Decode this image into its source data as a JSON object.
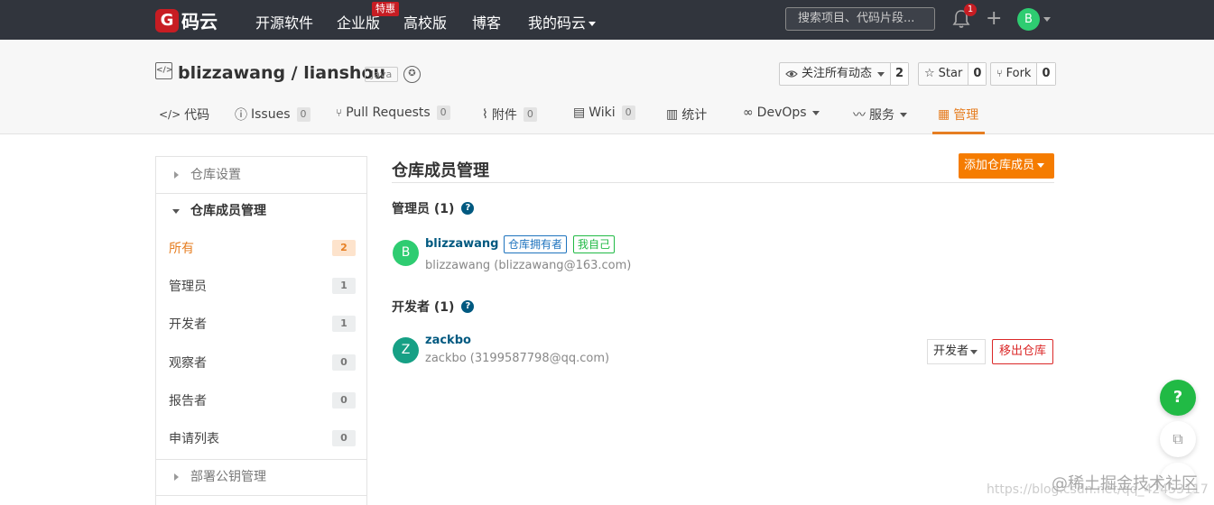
{
  "topnav": {
    "logo_mark": "G",
    "logo_text": "码云",
    "items": [
      "开源软件",
      "企业版",
      "高校版",
      "博客",
      "我的码云"
    ],
    "promo_badge": "特惠",
    "search_placeholder": "搜索项目、代码片段...",
    "notification_count": "1",
    "plus": "+",
    "user_initial": "B"
  },
  "repo": {
    "icon": "</>",
    "title": "blizzawang / lianshou",
    "language": "Java",
    "watch_label": "关注所有动态",
    "watch_count": "2",
    "star_label": "Star",
    "star_count": "0",
    "fork_label": "Fork",
    "fork_count": "0"
  },
  "tabs": {
    "code": "代码",
    "issues": "Issues",
    "issues_count": "0",
    "pulls": "Pull Requests",
    "pulls_count": "0",
    "attachments": "附件",
    "attachments_count": "0",
    "wiki": "Wiki",
    "wiki_count": "0",
    "stats": "统计",
    "devops": "DevOps",
    "services": "服务",
    "manage": "管理"
  },
  "sidebar": {
    "repo_settings": "仓库设置",
    "member_mgmt": "仓库成员管理",
    "items": [
      {
        "label": "所有",
        "count": "2"
      },
      {
        "label": "管理员",
        "count": "1"
      },
      {
        "label": "开发者",
        "count": "1"
      },
      {
        "label": "观察者",
        "count": "0"
      },
      {
        "label": "报告者",
        "count": "0"
      },
      {
        "label": "申请列表",
        "count": "0"
      }
    ],
    "deploy_keys": "部署公钥管理"
  },
  "main": {
    "title": "仓库成员管理",
    "add_button": "添加仓库成员",
    "admins_heading": "管理员 (1)",
    "devs_heading": "开发者 (1)",
    "help": "?",
    "admin": {
      "initial": "B",
      "name": "blizzawang",
      "tag_owner": "仓库拥有者",
      "tag_self": "我自己",
      "sub": "blizzawang (blizzawang@163.com)"
    },
    "dev": {
      "initial": "Z",
      "name": "zackbo",
      "sub": "zackbo (3199587798@qq.com)",
      "role": "开发者",
      "remove": "移出仓库"
    }
  },
  "floating": {
    "help": "?",
    "edit": "⧉"
  },
  "watermark": {
    "text": "@稀土掘金技术社区",
    "url": "https://blog.csdn.net/qq_42453117"
  },
  "colors": {
    "nav_bg": "#31353d",
    "accent": "#e67e22",
    "add_button": "#f57c00",
    "link": "#005980",
    "remove": "#db2828",
    "avatar_admin": "#2ecc71",
    "avatar_dev": "#16a085"
  }
}
